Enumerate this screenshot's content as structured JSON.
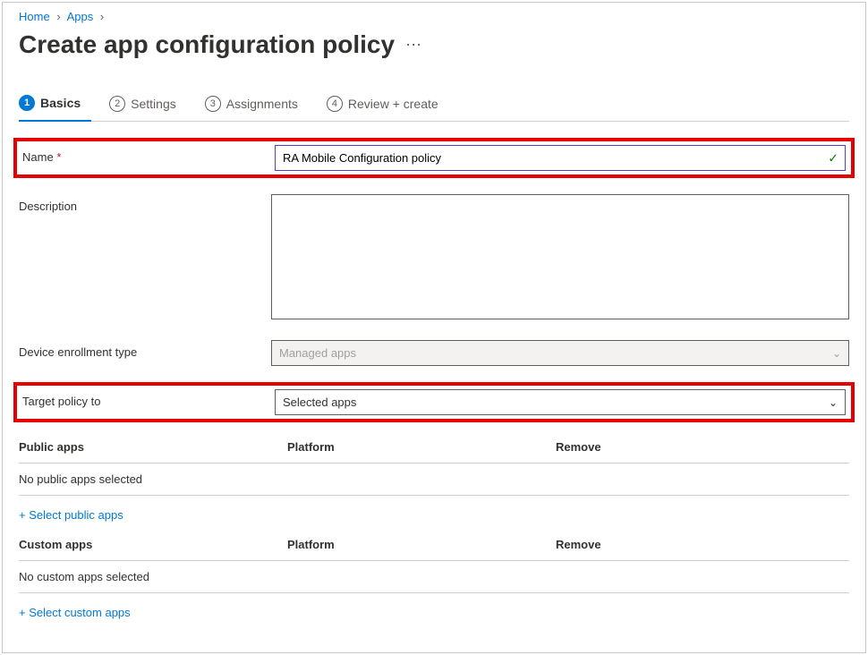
{
  "breadcrumb": {
    "home": "Home",
    "apps": "Apps"
  },
  "page": {
    "title": "Create app configuration policy"
  },
  "tabs": [
    {
      "num": "1",
      "label": "Basics"
    },
    {
      "num": "2",
      "label": "Settings"
    },
    {
      "num": "3",
      "label": "Assignments"
    },
    {
      "num": "4",
      "label": "Review + create"
    }
  ],
  "form": {
    "name_label": "Name",
    "required_marker": "*",
    "name_value": "RA Mobile Configuration policy",
    "description_label": "Description",
    "description_value": "",
    "enrollment_label": "Device enrollment type",
    "enrollment_value": "Managed apps",
    "target_label": "Target policy to",
    "target_value": "Selected apps"
  },
  "public_apps": {
    "header_apps": "Public apps",
    "header_platform": "Platform",
    "header_remove": "Remove",
    "empty": "No public apps selected",
    "select_link": "+ Select public apps"
  },
  "custom_apps": {
    "header_apps": "Custom apps",
    "header_platform": "Platform",
    "header_remove": "Remove",
    "empty": "No custom apps selected",
    "select_link": "+ Select custom apps"
  }
}
